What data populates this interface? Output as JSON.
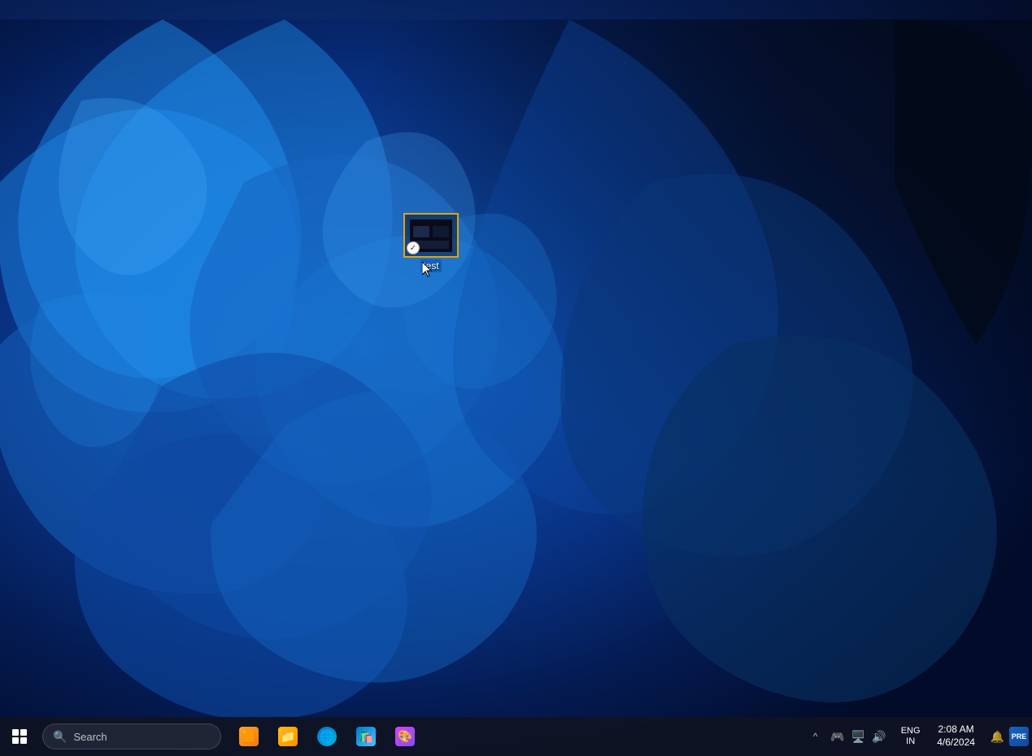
{
  "desktop": {
    "wallpaper_description": "Windows 11 blue bloom wallpaper"
  },
  "desktop_icon": {
    "label": "test",
    "selected": true,
    "border_color": "#e8a000"
  },
  "taskbar": {
    "start_label": "Start",
    "search_placeholder": "Search",
    "apps": [
      {
        "id": "widgets",
        "label": "Widgets",
        "icon_type": "widgets"
      },
      {
        "id": "file-explorer",
        "label": "File Explorer",
        "icon_type": "files"
      },
      {
        "id": "edge",
        "label": "Microsoft Edge",
        "icon_type": "edge"
      },
      {
        "id": "store",
        "label": "Microsoft Store",
        "icon_type": "store"
      },
      {
        "id": "paint",
        "label": "Paint",
        "icon_type": "paint"
      }
    ],
    "tray": {
      "overflow_label": "^",
      "lang_primary": "ENG",
      "lang_secondary": "IN",
      "monitor_icon": "monitor",
      "volume_icon": "volume",
      "notification_icon": "bell",
      "time": "2:08 AM",
      "date": "4/6/2024",
      "extras_label": "PRE"
    }
  }
}
